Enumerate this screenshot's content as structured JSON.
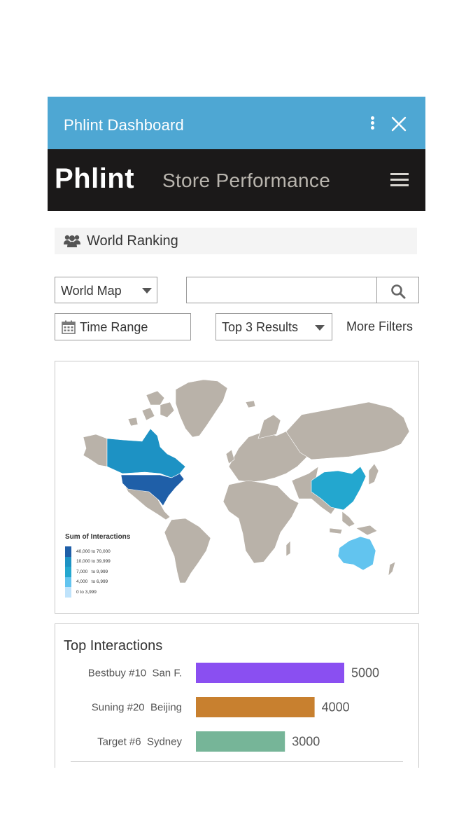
{
  "window": {
    "title": "Phlint Dashboard"
  },
  "appbar": {
    "brand": "Phlint",
    "page_title": "Store Performance"
  },
  "section": {
    "label": "World Ranking",
    "icon": "users-icon"
  },
  "filters": {
    "view_select": {
      "value": "World Map"
    },
    "search": {
      "value": "",
      "placeholder": ""
    },
    "time_range": {
      "label": "Time Range",
      "icon": "calendar-icon"
    },
    "results_select": {
      "value": "Top 3 Results"
    },
    "more_filters": "More Filters"
  },
  "map": {
    "legend_title": "Sum of Interactions",
    "legend": [
      {
        "label": "40,000 to 70,000",
        "color": "#1f5fa8"
      },
      {
        "label": "10,000 to 39,999",
        "color": "#1d92c4"
      },
      {
        "label": "7,000   to 9,999",
        "color": "#23a7cf"
      },
      {
        "label": "4,000   to 6,999",
        "color": "#62c4ef"
      },
      {
        "label": "0 to 3,999",
        "color": "#bfe3fb"
      }
    ],
    "land_color": "#b9b2a9",
    "highlighted_regions": [
      {
        "region": "United States",
        "color": "#1f5fa8"
      },
      {
        "region": "Canada",
        "color": "#1d92c4"
      },
      {
        "region": "China",
        "color": "#23a7cf"
      },
      {
        "region": "Australia",
        "color": "#62c4ef"
      }
    ]
  },
  "top_interactions": {
    "title": "Top Interactions",
    "chart_data": {
      "type": "bar",
      "orientation": "horizontal",
      "title": "Top Interactions",
      "categories": [
        "Bestbuy #10  San F.",
        "Suning #20  Beijing",
        "Target #6  Sydney"
      ],
      "values": [
        5000,
        4000,
        3000
      ],
      "colors": [
        "#8a4ff1",
        "#c8802f",
        "#76b598"
      ]
    }
  },
  "colors": {
    "title_bar": "#4ea7d3",
    "app_bar": "#1b1919"
  }
}
